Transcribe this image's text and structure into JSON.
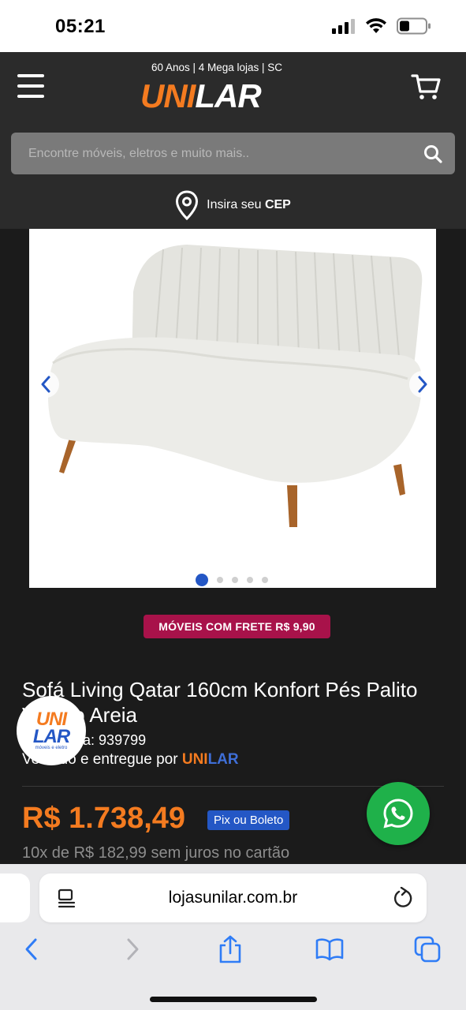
{
  "status_bar": {
    "time": "05:21"
  },
  "header": {
    "tagline": "60 Anos | 4 Mega lojas | SC",
    "logo_part1": "UNI",
    "logo_part2": "LAR",
    "search_placeholder": "Encontre móveis, eletros e muito mais..",
    "cep_prefix": "Insira seu",
    "cep_bold": "CEP"
  },
  "product": {
    "gallery": {
      "image_count": 5,
      "active_index": 1
    },
    "promo": "MÓVEIS COM FRETE R$ 9,90",
    "title": "Sofá Living Qatar 160cm Konfort Pés Palito Veludo Areia",
    "reference": "Referência: 939799",
    "seller_prefix": "Vendido e entregue por ",
    "seller_uni": "UNI",
    "seller_lar": "LAR",
    "price": "R$ 1.738,49",
    "payment_badge": "Pix ou Boleto",
    "installments": "10x de R$ 182,99 sem juros no cartão"
  },
  "brand_badge": {
    "line1": "UNI",
    "line2": "LAR",
    "sub": "móveis e eletro"
  },
  "browser": {
    "url": "lojasunilar.com.br"
  },
  "colors": {
    "brand_orange": "#f47b20",
    "brand_blue": "#2457c5",
    "promo_magenta": "#a8124a",
    "whatsapp_green": "#1fb14a",
    "header_bg": "#2b2b2b"
  },
  "icons": [
    "signal-icon",
    "wifi-icon",
    "battery-icon",
    "hamburger-menu-icon",
    "cart-icon",
    "search-icon",
    "location-pin-icon",
    "chevron-left-icon",
    "chevron-right-icon",
    "whatsapp-icon",
    "reader-icon",
    "reload-icon",
    "back-icon",
    "forward-icon",
    "share-icon",
    "bookmarks-icon",
    "tabs-icon"
  ]
}
